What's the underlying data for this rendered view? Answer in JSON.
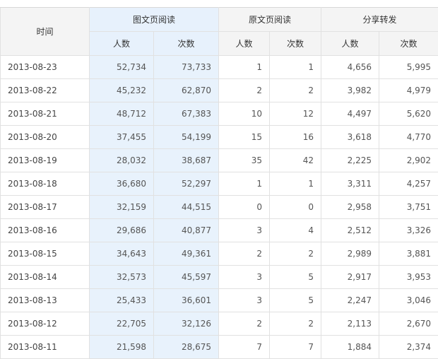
{
  "table": {
    "header": {
      "time": "时间",
      "groups": [
        {
          "label": "图文页阅读",
          "sub": [
            "人数",
            "次数"
          ]
        },
        {
          "label": "原文页阅读",
          "sub": [
            "人数",
            "次数"
          ]
        },
        {
          "label": "分享转发",
          "sub": [
            "人数",
            "次数"
          ]
        }
      ]
    },
    "rows": [
      {
        "date": "2013-08-23",
        "values": [
          "52,734",
          "73,733",
          "1",
          "1",
          "4,656",
          "5,995"
        ]
      },
      {
        "date": "2013-08-22",
        "values": [
          "45,232",
          "62,870",
          "2",
          "2",
          "3,982",
          "4,979"
        ]
      },
      {
        "date": "2013-08-21",
        "values": [
          "48,712",
          "67,383",
          "10",
          "12",
          "4,497",
          "5,620"
        ]
      },
      {
        "date": "2013-08-20",
        "values": [
          "37,455",
          "54,199",
          "15",
          "16",
          "3,618",
          "4,770"
        ]
      },
      {
        "date": "2013-08-19",
        "values": [
          "28,032",
          "38,687",
          "35",
          "42",
          "2,225",
          "2,902"
        ]
      },
      {
        "date": "2013-08-18",
        "values": [
          "36,680",
          "52,297",
          "1",
          "1",
          "3,311",
          "4,257"
        ]
      },
      {
        "date": "2013-08-17",
        "values": [
          "32,159",
          "44,515",
          "0",
          "0",
          "2,958",
          "3,751"
        ]
      },
      {
        "date": "2013-08-16",
        "values": [
          "29,686",
          "40,877",
          "3",
          "4",
          "2,512",
          "3,326"
        ]
      },
      {
        "date": "2013-08-15",
        "values": [
          "34,643",
          "49,361",
          "2",
          "2",
          "2,989",
          "3,881"
        ]
      },
      {
        "date": "2013-08-14",
        "values": [
          "32,573",
          "45,597",
          "3",
          "5",
          "2,917",
          "3,953"
        ]
      },
      {
        "date": "2013-08-13",
        "values": [
          "25,433",
          "36,601",
          "3",
          "5",
          "2,247",
          "3,046"
        ]
      },
      {
        "date": "2013-08-12",
        "values": [
          "22,705",
          "32,126",
          "2",
          "2",
          "2,113",
          "2,670"
        ]
      },
      {
        "date": "2013-08-11",
        "values": [
          "21,598",
          "28,675",
          "7",
          "7",
          "1,884",
          "2,374"
        ]
      }
    ]
  }
}
